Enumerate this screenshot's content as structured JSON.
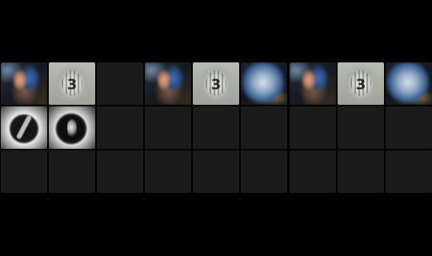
{
  "panels": [
    {
      "name": "panel-1",
      "slots": [
        {
          "kind": "photo",
          "icon": "blue-figure-thumbnail"
        },
        {
          "kind": "photo",
          "icon": "jersey-thumbnail",
          "label": "3"
        },
        {
          "kind": "empty"
        },
        {
          "kind": "photo",
          "icon": "bw-dark-circle-thumbnail"
        },
        {
          "kind": "photo",
          "icon": "bw-face-circle-thumbnail"
        },
        {
          "kind": "empty"
        },
        {
          "kind": "empty"
        },
        {
          "kind": "empty"
        },
        {
          "kind": "empty"
        }
      ]
    },
    {
      "name": "panel-2",
      "slots": [
        {
          "kind": "photo",
          "icon": "blue-figure-thumbnail"
        },
        {
          "kind": "photo",
          "icon": "jersey-thumbnail",
          "label": "3"
        },
        {
          "kind": "photo",
          "icon": "ball-thumbnail"
        },
        {
          "kind": "empty"
        },
        {
          "kind": "empty"
        },
        {
          "kind": "empty"
        },
        {
          "kind": "empty"
        },
        {
          "kind": "empty"
        },
        {
          "kind": "empty"
        }
      ]
    },
    {
      "name": "panel-3",
      "slots": [
        {
          "kind": "photo",
          "icon": "blue-figure-thumbnail"
        },
        {
          "kind": "photo",
          "icon": "jersey-thumbnail",
          "label": "3"
        },
        {
          "kind": "photo",
          "icon": "ball-thumbnail"
        },
        {
          "kind": "empty"
        },
        {
          "kind": "empty"
        },
        {
          "kind": "empty"
        },
        {
          "kind": "empty"
        },
        {
          "kind": "empty"
        },
        {
          "kind": "empty"
        }
      ]
    }
  ],
  "colors": {
    "background": "#000000",
    "empty_slot": "#1b1b1b"
  }
}
